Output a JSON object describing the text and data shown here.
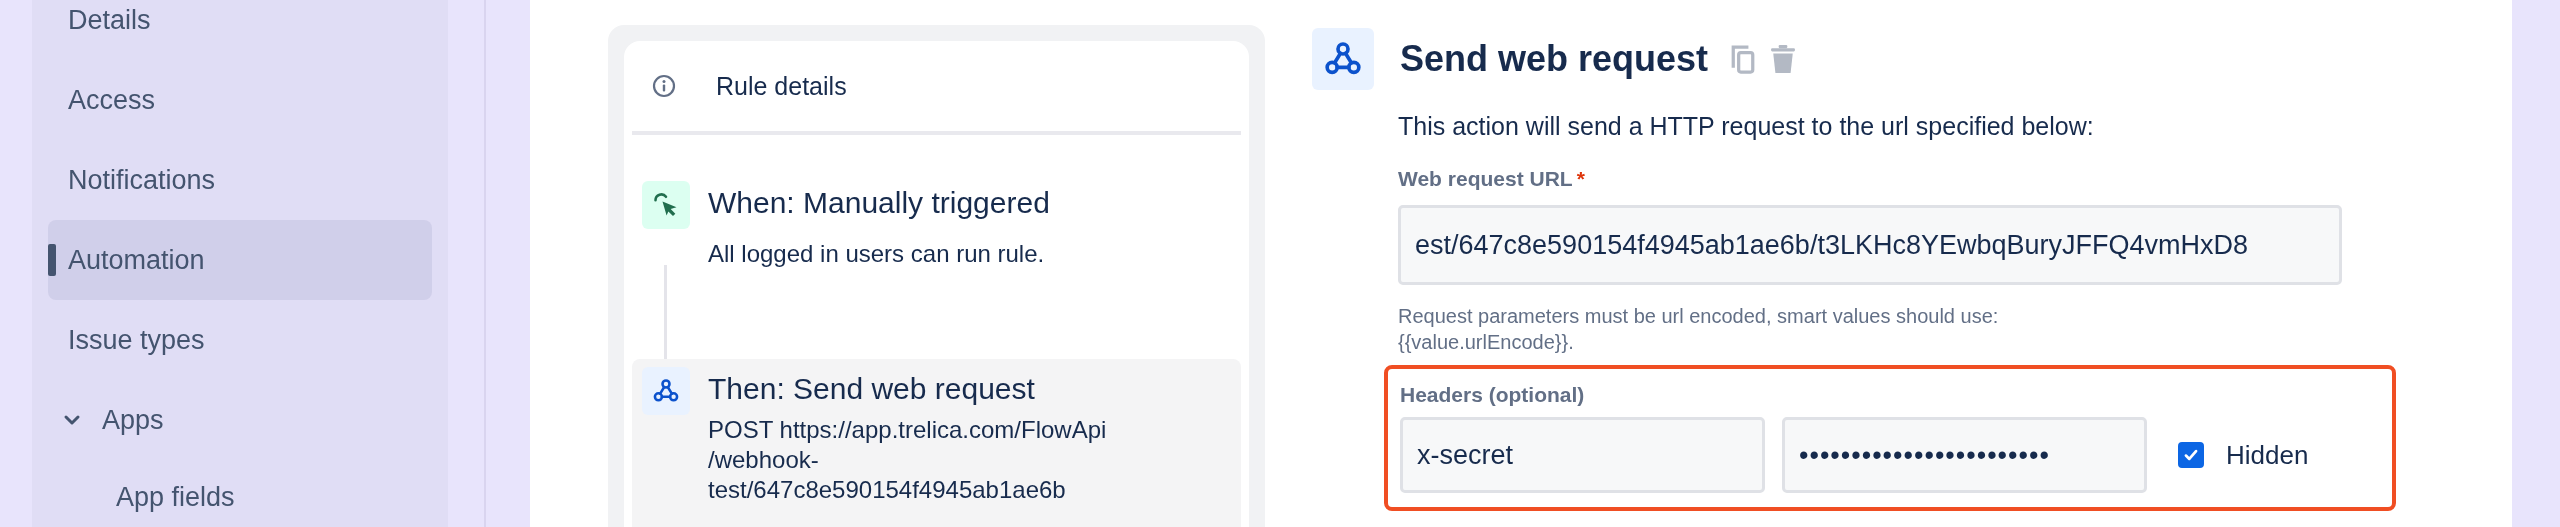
{
  "sidebar": {
    "items": [
      {
        "label": "Details",
        "selected": false
      },
      {
        "label": "Access",
        "selected": false
      },
      {
        "label": "Notifications",
        "selected": false
      },
      {
        "label": "Automation",
        "selected": true
      },
      {
        "label": "Issue types",
        "selected": false
      },
      {
        "label": "Apps",
        "selected": false,
        "expanded": true,
        "children": [
          {
            "label": "App fields",
            "selected": false
          }
        ]
      }
    ]
  },
  "rule_panel": {
    "title": "Rule details",
    "steps": [
      {
        "kind": "trigger",
        "title": "When: Manually triggered",
        "lines": [
          "All logged in users can run rule."
        ],
        "selected": false
      },
      {
        "kind": "action",
        "title": "Then: Send web request",
        "lines": [
          "POST https://app.trelica.com/FlowApi",
          "/webhook-",
          "test/647c8e590154f4945ab1ae6b"
        ],
        "selected": true
      }
    ]
  },
  "action": {
    "title": "Send web request",
    "description": "This action will send a HTTP request to the url specified below:",
    "url_field": {
      "label": "Web request URL",
      "required_mark": "*",
      "value": "est/647c8e590154f4945ab1ae6b/t3LKHc8YEwbqBuryJFFQ4vmHxD8"
    },
    "help": "Request parameters must be url encoded, smart values should use:\n{{value.urlEncode}}.",
    "headers": {
      "label": "Headers (optional)",
      "highlighted": true,
      "name": "x-secret",
      "value": "••••••••••••••••••••••••",
      "hidden_label": "Hidden",
      "hidden": true
    }
  }
}
